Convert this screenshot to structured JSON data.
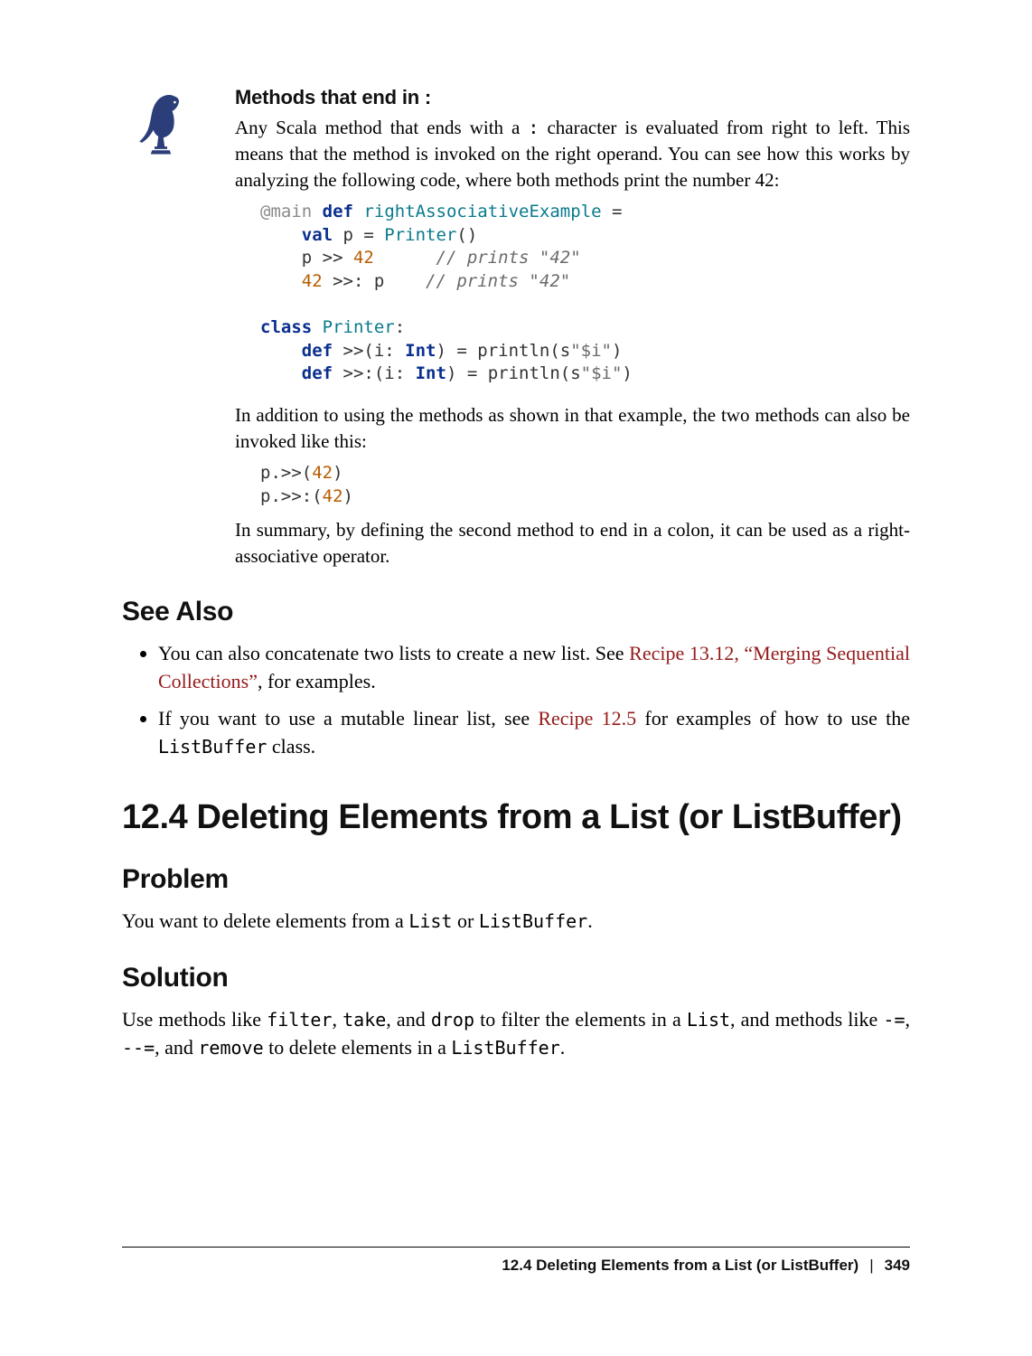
{
  "note": {
    "title": "Methods that end in :",
    "para1_a": "Any Scala method that ends with a ",
    "para1_code": ":",
    "para1_b": " character is evaluated from right to left. This means that the method is invoked on the right operand. You can see how this works by analyzing the following code, where both methods print the number 42:",
    "code1": {
      "l1_anno": "@main",
      "l1_def": "def",
      "l1_name": "rightAssociativeExample",
      "l1_eq": " =",
      "l2_val": "val",
      "l2_rest_a": " p = ",
      "l2_cls": "Printer",
      "l2_rest_b": "()",
      "l3_a": "p >> ",
      "l3_num": "42",
      "l3_sp": "      ",
      "l3_cmt": "// prints \"42\"",
      "l4_num": "42",
      "l4_a": " >>: p    ",
      "l4_cmt": "// prints \"42\"",
      "l6_class": "class",
      "l6_name": "Printer",
      "l6_colon": ":",
      "l7_def": "def",
      "l7_a": " >>(i: ",
      "l7_type": "Int",
      "l7_b": ") = println(s",
      "l7_str": "\"$i\"",
      "l7_c": ")",
      "l8_def": "def",
      "l8_a": " >>:(i: ",
      "l8_type": "Int",
      "l8_b": ") = println(s",
      "l8_str": "\"$i\"",
      "l8_c": ")"
    },
    "para2": "In addition to using the methods as shown in that example, the two methods can also be invoked like this:",
    "code2": {
      "l1_a": "p.>>(",
      "l1_num": "42",
      "l1_b": ")",
      "l2_a": "p.>>:(",
      "l2_num": "42",
      "l2_b": ")"
    },
    "para3": "In summary, by defining the second method to end in a colon, it can be used as a right-associative operator."
  },
  "see_also": {
    "heading": "See Also",
    "item1_a": "You can also concatenate two lists to create a new list. See ",
    "item1_link": "Recipe 13.12, “Merging Sequential Collections”",
    "item1_b": ", for examples.",
    "item2_a": "If you want to use a mutable linear list, see ",
    "item2_link": "Recipe 12.5",
    "item2_b": " for examples of how to use the ",
    "item2_code": "ListBuffer",
    "item2_c": " class."
  },
  "section": {
    "heading": "12.4 Deleting Elements from a List (or ListBuffer)",
    "problem_h": "Problem",
    "problem_a": "You want to delete elements from a ",
    "problem_code1": "List",
    "problem_b": " or ",
    "problem_code2": "ListBuffer",
    "problem_c": ".",
    "solution_h": "Solution",
    "solution_a": "Use methods like ",
    "solution_code1": "filter",
    "solution_b": ", ",
    "solution_code2": "take",
    "solution_c": ", and ",
    "solution_code3": "drop",
    "solution_d": " to filter the elements in a ",
    "solution_code4": "List",
    "solution_e": ", and methods like ",
    "solution_code5": "-=",
    "solution_f": ", ",
    "solution_code6": "--=",
    "solution_g": ", and ",
    "solution_code7": "remove",
    "solution_h2": " to delete elements in a ",
    "solution_code8": "ListBuffer",
    "solution_i": "."
  },
  "footer": {
    "title": "12.4 Deleting Elements from a List (or ListBuffer)",
    "sep": "|",
    "page": "349"
  }
}
